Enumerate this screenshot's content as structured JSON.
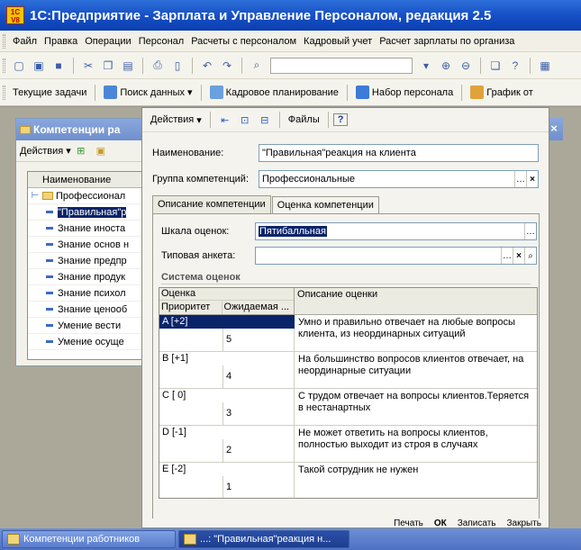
{
  "app": {
    "title": "1С:Предприятие - Зарплата и Управление Персоналом, редакция 2.5",
    "icon_text": "1С\nV8"
  },
  "menu": [
    "Файл",
    "Правка",
    "Операции",
    "Персонал",
    "Расчеты с персоналом",
    "Кадровый учет",
    "Расчет зарплаты по организа"
  ],
  "toolbar2": [
    "Текущие задачи",
    "Поиск данных",
    "Кадровое планирование",
    "Набор персонала",
    "График от"
  ],
  "bg_window": {
    "title": "Компетенции ра",
    "actions": "Действия",
    "column_header": "Наименование",
    "rows": [
      "Профессионал",
      "\"Правильная\"р",
      "Знание иноста",
      "Знание основ н",
      "Знание предпр",
      "Знание продук",
      "Знание психол",
      "Знание ценооб",
      "Умение вести",
      "Умение осуще"
    ]
  },
  "dialog": {
    "toolbar": {
      "actions": "Действия",
      "files": "Файлы",
      "help": "?"
    },
    "name_label": "Наименование:",
    "name_value": "\"Правильная\"реакция на клиента",
    "group_label": "Группа компетенций:",
    "group_value": "Профессиональные",
    "tabs": [
      "Описание компетенции",
      "Оценка компетенции"
    ],
    "scale_label": "Шкала оценок:",
    "scale_value": "Пятибалльная",
    "survey_label": "Типовая анкета:",
    "survey_value": "",
    "section_title": "Система оценок",
    "grid": {
      "col_grade": "Оценка",
      "col_priority": "Приоритет",
      "col_expected": "Ожидаемая ...",
      "col_description": "Описание оценки",
      "rows": [
        {
          "grade": "A [+2]",
          "priority": "5",
          "description": "Умно и правильно отвечает на любые вопросы клиента, из неординарных ситуаций"
        },
        {
          "grade": "B [+1]",
          "priority": "4",
          "description": "На большинство вопросов клиентов отвечает, на неординарные ситуации"
        },
        {
          "grade": "C [ 0]",
          "priority": "3",
          "description": "С трудом отвечает на вопросы клиентов.Теряется в нестанартных"
        },
        {
          "grade": "D [-1]",
          "priority": "2",
          "description": "Не может ответить на вопросы клиентов, полностью выходит из строя в случаях"
        },
        {
          "grade": "E [-2]",
          "priority": "1",
          "description": "Такой сотрудник не нужен"
        }
      ]
    },
    "bottom_buttons": [
      "Печать",
      "ОК",
      "Записать",
      "Закрыть"
    ]
  },
  "taskbar": [
    "Компетенции работников",
    "...: \"Правильная\"реакция н..."
  ]
}
